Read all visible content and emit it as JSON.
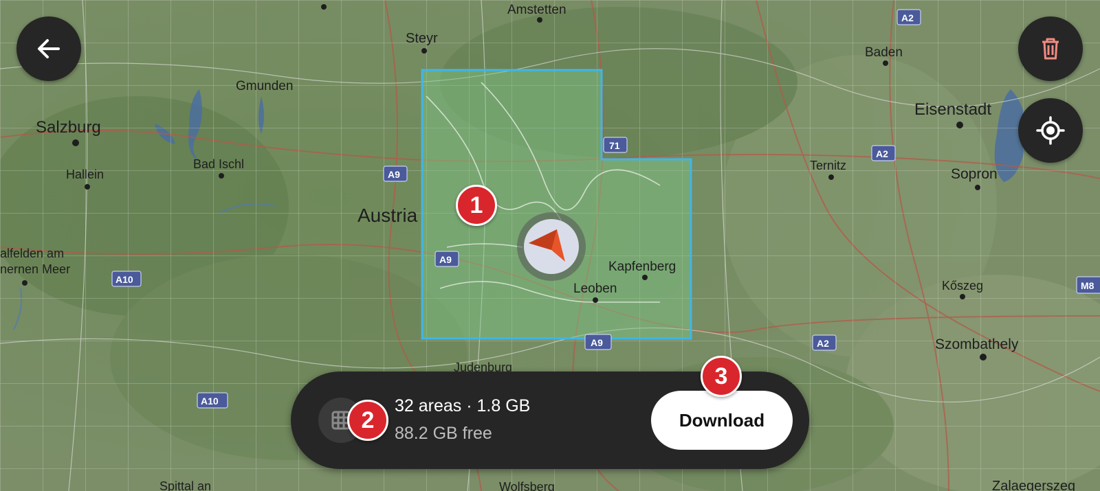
{
  "map": {
    "cities": [
      {
        "name": "Amstetten"
      },
      {
        "name": "Steyr"
      },
      {
        "name": "Gmunden"
      },
      {
        "name": "Salzburg"
      },
      {
        "name": "Hallein"
      },
      {
        "name": "Bad Ischl"
      },
      {
        "name": "Austria"
      },
      {
        "name": "alfelden am"
      },
      {
        "name": "nernen Meer"
      },
      {
        "name": "Baden"
      },
      {
        "name": "Eisenstadt"
      },
      {
        "name": "Ternitz"
      },
      {
        "name": "Sopron"
      },
      {
        "name": "Kapfenberg"
      },
      {
        "name": "Leoben"
      },
      {
        "name": "Kőszeg"
      },
      {
        "name": "Szombathely"
      },
      {
        "name": "Judenburg"
      },
      {
        "name": "Spittal an"
      },
      {
        "name": "Wolfsberg"
      },
      {
        "name": "Zalaegerszeg"
      }
    ],
    "road_shields": [
      {
        "label": "A2"
      },
      {
        "label": "A2"
      },
      {
        "label": "A9"
      },
      {
        "label": "71"
      },
      {
        "label": "A9"
      },
      {
        "label": "A10"
      },
      {
        "label": "A9"
      },
      {
        "label": "A2"
      },
      {
        "label": "A10"
      },
      {
        "label": "M8"
      }
    ],
    "selection_color": "#3fb6e8",
    "position_marker_color": "#e8552a"
  },
  "controls": {
    "back_icon": "arrow-left-icon",
    "delete_icon": "trash-icon",
    "locate_icon": "crosshair-icon"
  },
  "badges": [
    "1",
    "2",
    "3"
  ],
  "bottom_bar": {
    "grid_icon": "grid-icon",
    "summary": "32 areas · 1.8 GB",
    "free_space": "88.2 GB free",
    "download_label": "Download"
  }
}
